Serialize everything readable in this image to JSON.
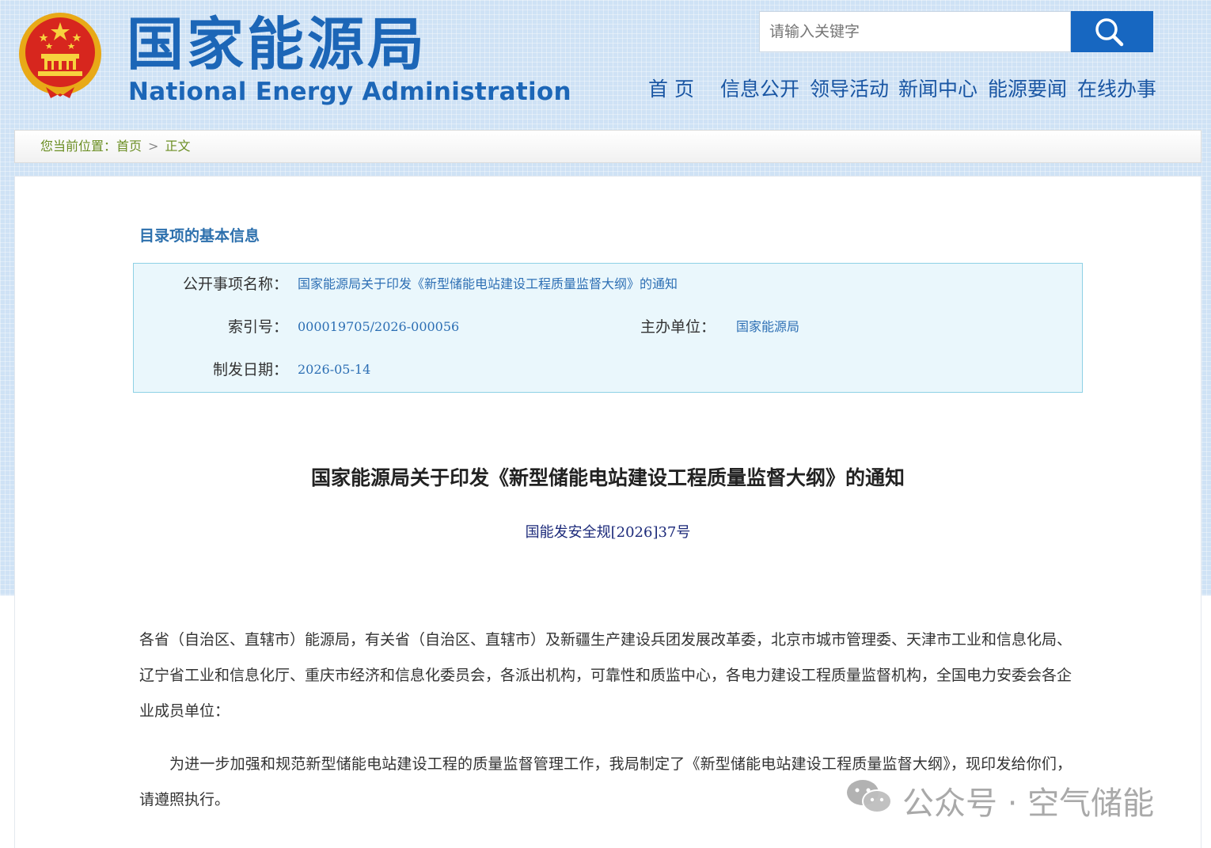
{
  "header": {
    "logo_cn": "国家能源局",
    "logo_en": "National Energy Administration",
    "search": {
      "placeholder": "请输入关键字"
    },
    "nav": [
      {
        "label": "首 页"
      },
      {
        "label": "信息公开"
      },
      {
        "label": "领导活动"
      },
      {
        "label": "新闻中心"
      },
      {
        "label": "能源要闻"
      },
      {
        "label": "在线办事"
      }
    ]
  },
  "breadcrumb": {
    "prefix": "您当前位置：",
    "home": "首页",
    "separator": ">",
    "current": "正文"
  },
  "info": {
    "title": "目录项的基本信息",
    "name_label": "公开事项名称：",
    "name_value": "国家能源局关于印发《新型储能电站建设工程质量监督大纲》的通知",
    "index_label": "索引号：",
    "index_value": "000019705/2026-000056",
    "org_label": "主办单位：",
    "org_value": "国家能源局",
    "date_label": "制发日期：",
    "date_value": "2026-05-14"
  },
  "document": {
    "title": "国家能源局关于印发《新型储能电站建设工程质量监督大纲》的通知",
    "number": "国能发安全规[2026]37号",
    "paragraphs": [
      "各省（自治区、直辖市）能源局，有关省（自治区、直辖市）及新疆生产建设兵团发展改革委，北京市城市管理委、天津市工业和信息化局、辽宁省工业和信息化厅、重庆市经济和信息化委员会，各派出机构，可靠性和质监中心，各电力建设工程质量监督机构，全国电力安委会各企业成员单位：",
      "为进一步加强和规范新型储能电站建设工程的质量监督管理工作，我局制定了《新型储能电站建设工程质量监督大纲》，现印发给你们，请遵照执行。"
    ]
  },
  "watermark": {
    "text": "公众号 · 空气储能",
    "icon": "wechat-icon"
  },
  "colors": {
    "brand_blue": "#1c66b7",
    "search_button": "#1767c1",
    "info_box_bg": "#eaf7fc",
    "info_box_border": "#8ed1e5",
    "link_value": "#2d6fb4",
    "breadcrumb_text": "#6b8e23"
  }
}
